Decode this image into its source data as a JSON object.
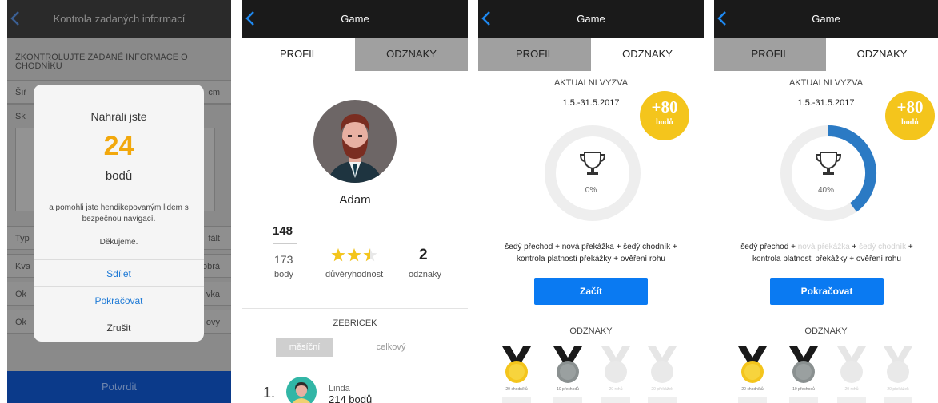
{
  "screen1": {
    "title": "Kontrola zadaných informací",
    "form_title": "ZKONTROLUJTE ZADANÉ INFORMACE O CHODNÍKU",
    "rows": [
      {
        "label": "Šíř",
        "value": "cm"
      },
      {
        "label": "Sk",
        "value": ""
      },
      {
        "label": "Typ",
        "value": "fált"
      },
      {
        "label": "Kva",
        "value": "obrá"
      },
      {
        "label": "Ok",
        "value": "vka"
      },
      {
        "label": "Ok",
        "value": "ovy"
      }
    ],
    "submit_label": "Potvrdit",
    "modal": {
      "heading": "Nahráli jste",
      "points": "24",
      "unit": "bodů",
      "text": "a pomohli jste hendikepovaným lidem s bezpečnou navigací.",
      "thanks": "Děkujeme.",
      "share": "Sdílet",
      "continue": "Pokračovat",
      "cancel": "Zrušit"
    }
  },
  "screen2": {
    "title": "Game",
    "tabs": [
      "PROFIL",
      "ODZNAKY"
    ],
    "name": "Adam",
    "score": "148",
    "points_value": "173",
    "points_label": "body",
    "trust_label": "důvěryhodnost",
    "trust_rating": 2.5,
    "badges_value": "2",
    "badges_label": "odznaky",
    "leaderboard_title": "ZEBRICEK",
    "segments": [
      "měsíční",
      "celkový"
    ],
    "leader": {
      "rank": "1.",
      "name": "Linda",
      "points": "214 bodů"
    }
  },
  "screen3": {
    "title": "Game",
    "tabs": [
      "PROFIL",
      "ODZNAKY"
    ],
    "challenge_title": "AKTUALNI VYZVA",
    "date": "1.5.-31.5.2017",
    "bonus_value": "+80",
    "bonus_unit": "bodů",
    "progress": 0,
    "progress_label": "0%",
    "tasks": [
      "šedý přechod",
      "nová překážka",
      "šedý chodník",
      "kontrola platnosti překážky",
      "ověření rohu"
    ],
    "cta": "Začít",
    "badges_title": "ODZNAKY",
    "medals": [
      "20 chodníků",
      "10 přechodů",
      "20 rohů",
      "20 překážek"
    ]
  },
  "screen4": {
    "title": "Game",
    "tabs": [
      "PROFIL",
      "ODZNAKY"
    ],
    "challenge_title": "AKTUALNI VYZVA",
    "date": "1.5.-31.5.2017",
    "bonus_value": "+80",
    "bonus_unit": "bodů",
    "progress": 0.4,
    "progress_label": "40%",
    "tasks": [
      "šedý přechod",
      "nová překážka",
      "šedý chodník",
      "kontrola platnosti překážky",
      "ověření rohu"
    ],
    "cta": "Pokračovat",
    "badges_title": "ODZNAKY",
    "medals": [
      "20 chodníků",
      "10 přechodů",
      "20 rohů",
      "20 překážek"
    ]
  },
  "colors": {
    "accent_blue": "#0a7af2",
    "gold": "#f4c51c",
    "points_orange": "#f2a80c",
    "ring_progress": "#2b7ac4",
    "ring_track": "#eeeeee"
  }
}
